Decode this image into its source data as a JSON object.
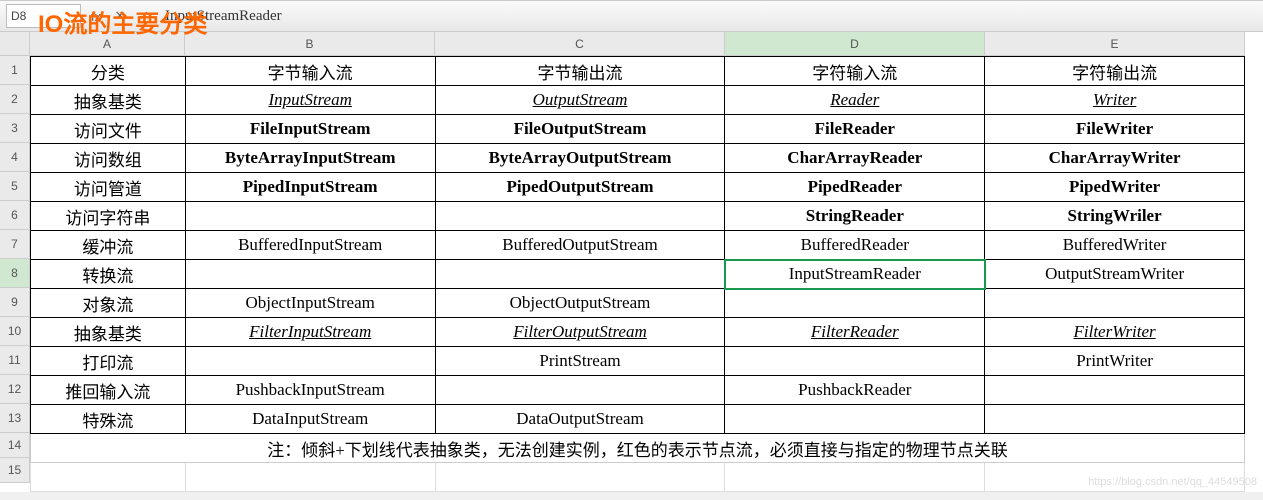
{
  "title_overlay": "IO流的主要分类",
  "formula_bar": {
    "cell_ref": "D8",
    "value": "InputStreamReader"
  },
  "col_headers": [
    "A",
    "B",
    "C",
    "D",
    "E"
  ],
  "row_headers": [
    "1",
    "2",
    "3",
    "4",
    "5",
    "6",
    "7",
    "8",
    "9",
    "10",
    "11",
    "12",
    "13",
    "14",
    "15"
  ],
  "selected": {
    "row": 8,
    "col": "D"
  },
  "chart_data": {
    "type": "table",
    "title": "IO流的主要分类",
    "note": "注：倾斜+下划线代表抽象类，无法创建实例，红色的表示节点流，必须直接与指定的物理节点关联",
    "columns": [
      "分类",
      "字节输入流",
      "字节输出流",
      "字符输入流",
      "字符输出流"
    ],
    "rows": [
      {
        "label": "抽象基类",
        "cells": [
          {
            "text": "InputStream",
            "style": "abstract"
          },
          {
            "text": "OutputStream",
            "style": "abstract"
          },
          {
            "text": "Reader",
            "style": "abstract"
          },
          {
            "text": "Writer",
            "style": "abstract"
          }
        ]
      },
      {
        "label": "访问文件",
        "cells": [
          {
            "text": "FileInputStream",
            "style": "red"
          },
          {
            "text": "FileOutputStream",
            "style": "red"
          },
          {
            "text": "FileReader",
            "style": "red"
          },
          {
            "text": "FileWriter",
            "style": "red"
          }
        ]
      },
      {
        "label": "访问数组",
        "cells": [
          {
            "text": "ByteArrayInputStream",
            "style": "red"
          },
          {
            "text": "ByteArrayOutputStream",
            "style": "red"
          },
          {
            "text": "CharArrayReader",
            "style": "red"
          },
          {
            "text": "CharArrayWriter",
            "style": "red"
          }
        ]
      },
      {
        "label": "访问管道",
        "cells": [
          {
            "text": "PipedInputStream",
            "style": "red"
          },
          {
            "text": "PipedOutputStream",
            "style": "red"
          },
          {
            "text": "PipedReader",
            "style": "red"
          },
          {
            "text": "PipedWriter",
            "style": "red"
          }
        ]
      },
      {
        "label": "访问字符串",
        "cells": [
          {
            "text": "",
            "style": ""
          },
          {
            "text": "",
            "style": ""
          },
          {
            "text": "StringReader",
            "style": "red"
          },
          {
            "text": "StringWriler",
            "style": "red"
          }
        ]
      },
      {
        "label": "缓冲流",
        "cells": [
          {
            "text": "BufferedInputStream",
            "style": ""
          },
          {
            "text": "BufferedOutputStream",
            "style": ""
          },
          {
            "text": "BufferedReader",
            "style": ""
          },
          {
            "text": "BufferedWriter",
            "style": ""
          }
        ]
      },
      {
        "label": "转换流",
        "cells": [
          {
            "text": "",
            "style": ""
          },
          {
            "text": "",
            "style": ""
          },
          {
            "text": "InputStreamReader",
            "style": ""
          },
          {
            "text": "OutputStreamWriter",
            "style": ""
          }
        ]
      },
      {
        "label": "对象流",
        "cells": [
          {
            "text": "ObjectInputStream",
            "style": ""
          },
          {
            "text": "ObjectOutputStream",
            "style": ""
          },
          {
            "text": "",
            "style": ""
          },
          {
            "text": "",
            "style": ""
          }
        ]
      },
      {
        "label": "抽象基类",
        "cells": [
          {
            "text": "FilterInputStream",
            "style": "abstract"
          },
          {
            "text": "FilterOutputStream",
            "style": "abstract"
          },
          {
            "text": "FilterReader",
            "style": "abstract"
          },
          {
            "text": "FilterWriter",
            "style": "abstract"
          }
        ]
      },
      {
        "label": "打印流",
        "cells": [
          {
            "text": "",
            "style": ""
          },
          {
            "text": "PrintStream",
            "style": ""
          },
          {
            "text": "",
            "style": ""
          },
          {
            "text": "PrintWriter",
            "style": ""
          }
        ]
      },
      {
        "label": "推回输入流",
        "cells": [
          {
            "text": "PushbackInputStream",
            "style": ""
          },
          {
            "text": "",
            "style": ""
          },
          {
            "text": "PushbackReader",
            "style": ""
          },
          {
            "text": "",
            "style": ""
          }
        ]
      },
      {
        "label": "特殊流",
        "cells": [
          {
            "text": "DataInputStream",
            "style": ""
          },
          {
            "text": "DataOutputStream",
            "style": ""
          },
          {
            "text": "",
            "style": ""
          },
          {
            "text": "",
            "style": ""
          }
        ]
      }
    ]
  },
  "watermark": "https://blog.csdn.net/qq_44549508"
}
